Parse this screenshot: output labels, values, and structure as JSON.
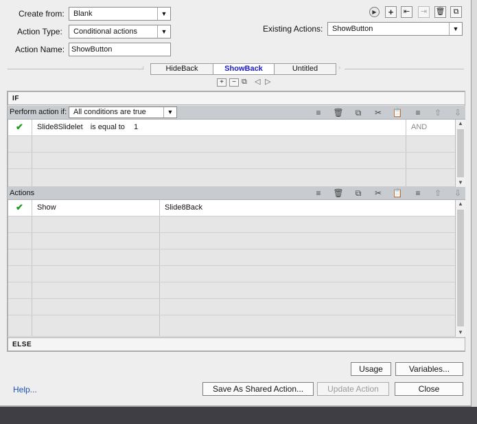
{
  "form": {
    "create_from_label": "Create from:",
    "create_from_value": "Blank",
    "action_type_label": "Action Type:",
    "action_type_value": "Conditional actions",
    "action_name_label": "Action Name:",
    "action_name_value": "ShowButton",
    "existing_actions_label": "Existing Actions:",
    "existing_actions_value": "ShowButton"
  },
  "toolbar_icons": [
    "play-icon",
    "add-icon",
    "import-icon",
    "export-icon",
    "delete-icon",
    "duplicate-icon"
  ],
  "tabs": [
    {
      "label": "HideBack",
      "active": false
    },
    {
      "label": "ShowBack",
      "active": true
    },
    {
      "label": "Untitled",
      "active": false
    }
  ],
  "tab_controls": [
    "add-tab-icon",
    "remove-tab-icon",
    "duplicate-tab-icon",
    "prev-tab-icon",
    "next-tab-icon"
  ],
  "if_section": {
    "header": "IF",
    "perform_label": "Perform action if:",
    "condition_mode": "All conditions are true",
    "rows": [
      {
        "checked": true,
        "variable": "Slide8Slidelet",
        "operator": "is equal to",
        "value": "1",
        "logic": "AND"
      },
      {
        "checked": false,
        "variable": "",
        "operator": "",
        "value": "",
        "logic": ""
      },
      {
        "checked": false,
        "variable": "",
        "operator": "",
        "value": "",
        "logic": ""
      },
      {
        "checked": false,
        "variable": "",
        "operator": "",
        "value": "",
        "logic": ""
      }
    ]
  },
  "actions_section": {
    "header": "Actions",
    "rows": [
      {
        "checked": true,
        "action": "Show",
        "target": "Slide8Back"
      },
      {
        "checked": false,
        "action": "",
        "target": ""
      },
      {
        "checked": false,
        "action": "",
        "target": ""
      },
      {
        "checked": false,
        "action": "",
        "target": ""
      },
      {
        "checked": false,
        "action": "",
        "target": ""
      },
      {
        "checked": false,
        "action": "",
        "target": ""
      },
      {
        "checked": false,
        "action": "",
        "target": ""
      },
      {
        "checked": false,
        "action": "",
        "target": ""
      }
    ]
  },
  "else_section": {
    "header": "ELSE"
  },
  "buttons": {
    "usage": "Usage",
    "variables": "Variables...",
    "save_shared": "Save As Shared Action...",
    "update": "Update Action",
    "close": "Close",
    "help": "Help..."
  },
  "colors": {
    "active_tab": "#1a1ad0",
    "help_link": "#1a4fb5",
    "check": "#1f9a1f",
    "gridbar": "#c8ccd1"
  }
}
